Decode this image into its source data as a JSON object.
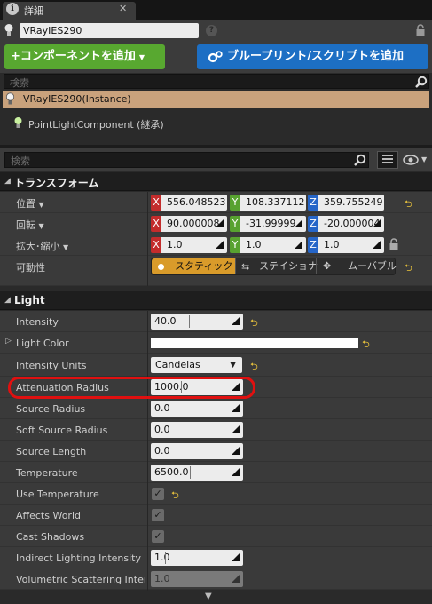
{
  "tab": {
    "title": "詳細"
  },
  "actor": {
    "name": "VRayIES290"
  },
  "buttons": {
    "add_component": "コンポーネントを追加",
    "blueprint": "ブループリント/スクリプトを追加"
  },
  "component_search": {
    "placeholder": "検索"
  },
  "components": [
    {
      "label": "VRayIES290(Instance)"
    },
    {
      "label": "PointLightComponent (継承)"
    }
  ],
  "details_search": {
    "placeholder": "検索"
  },
  "transform": {
    "title": "トランスフォーム",
    "location": {
      "label": "位置",
      "x": "556.048523",
      "y": "108.337112",
      "z": "359.755249"
    },
    "rotation": {
      "label": "回転",
      "x": "90.000008",
      "y": "-31.99999",
      "z": "-20.000004"
    },
    "scale": {
      "label": "拡大･縮小",
      "x": "1.0",
      "y": "1.0",
      "z": "1.0"
    },
    "mobility": {
      "label": "可動性",
      "options": [
        "スタティック",
        "ステイショナ",
        "ムーバブル"
      ],
      "selected": "スタティック"
    }
  },
  "light": {
    "title": "Light",
    "intensity": {
      "label": "Intensity",
      "value": "40.0"
    },
    "light_color": {
      "label": "Light Color",
      "color": "#ffffff"
    },
    "intensity_units": {
      "label": "Intensity Units",
      "value": "Candelas"
    },
    "attenuation_radius": {
      "label": "Attenuation Radius",
      "value": "1000.0"
    },
    "source_radius": {
      "label": "Source Radius",
      "value": "0.0"
    },
    "soft_source_radius": {
      "label": "Soft Source Radius",
      "value": "0.0"
    },
    "source_length": {
      "label": "Source Length",
      "value": "0.0"
    },
    "temperature": {
      "label": "Temperature",
      "value": "6500.0"
    },
    "use_temperature": {
      "label": "Use Temperature",
      "checked": true
    },
    "affects_world": {
      "label": "Affects World",
      "checked": true
    },
    "cast_shadows": {
      "label": "Cast Shadows",
      "checked": true
    },
    "indirect_lighting": {
      "label": "Indirect Lighting Intensity",
      "value": "1.0"
    },
    "volumetric": {
      "label": "Volumetric Scattering Intensi",
      "value": "1.0"
    }
  },
  "colors": {
    "add_component": "#58a830",
    "blueprint": "#1d6fc4",
    "selection": "#c9a27c",
    "mobility_active": "#d99b2a",
    "highlight": "#e01010"
  }
}
